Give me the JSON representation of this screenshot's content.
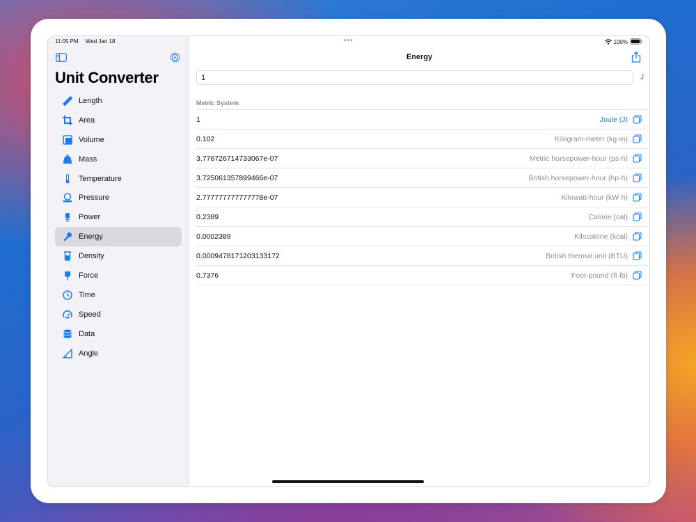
{
  "status": {
    "time": "11:05 PM",
    "date": "Wed Jan 18",
    "battery": "100%"
  },
  "sidebar": {
    "title": "Unit Converter",
    "items": [
      {
        "label": "Length",
        "icon": "ruler-icon"
      },
      {
        "label": "Area",
        "icon": "crop-icon"
      },
      {
        "label": "Volume",
        "icon": "cube-icon"
      },
      {
        "label": "Mass",
        "icon": "scalemass-icon"
      },
      {
        "label": "Temperature",
        "icon": "thermometer-icon"
      },
      {
        "label": "Pressure",
        "icon": "gauge-icon"
      },
      {
        "label": "Power",
        "icon": "lightbulb-icon"
      },
      {
        "label": "Energy",
        "icon": "wrench-icon",
        "selected": true
      },
      {
        "label": "Density",
        "icon": "beaker-icon"
      },
      {
        "label": "Force",
        "icon": "pin-icon"
      },
      {
        "label": "Time",
        "icon": "clock-icon"
      },
      {
        "label": "Speed",
        "icon": "speedometer-icon"
      },
      {
        "label": "Data",
        "icon": "database-icon"
      },
      {
        "label": "Angle",
        "icon": "angle-icon"
      }
    ]
  },
  "main": {
    "title": "Energy",
    "input_value": "1",
    "unit_symbol": "J",
    "section_header": "Metric System",
    "rows": [
      {
        "value": "1",
        "unit": "Joule (J)",
        "accent": true
      },
      {
        "value": "0.102",
        "unit": "Kilogram-meter (kg·m)"
      },
      {
        "value": "3.776726714733067e-07",
        "unit": "Metric horsepower-hour (ps·h)"
      },
      {
        "value": "3.725061357899466e-07",
        "unit": "British horsepower-hour (hp·h)"
      },
      {
        "value": "2.777777777777778e-07",
        "unit": "Kilowatt-hour (kW·h)"
      },
      {
        "value": "0.2389",
        "unit": "Calorie (cal)"
      },
      {
        "value": "0.0002389",
        "unit": "Kilocalorie (kcal)"
      },
      {
        "value": "0.0009478171203133172",
        "unit": "British thermal unit (BTU)"
      },
      {
        "value": "0.7376",
        "unit": "Foot-pound (ft·lb)"
      }
    ]
  },
  "colors": {
    "accent": "#1a7cf2",
    "selected_bg": "#d9d9de",
    "sidebar_bg": "#f2f2f7"
  }
}
